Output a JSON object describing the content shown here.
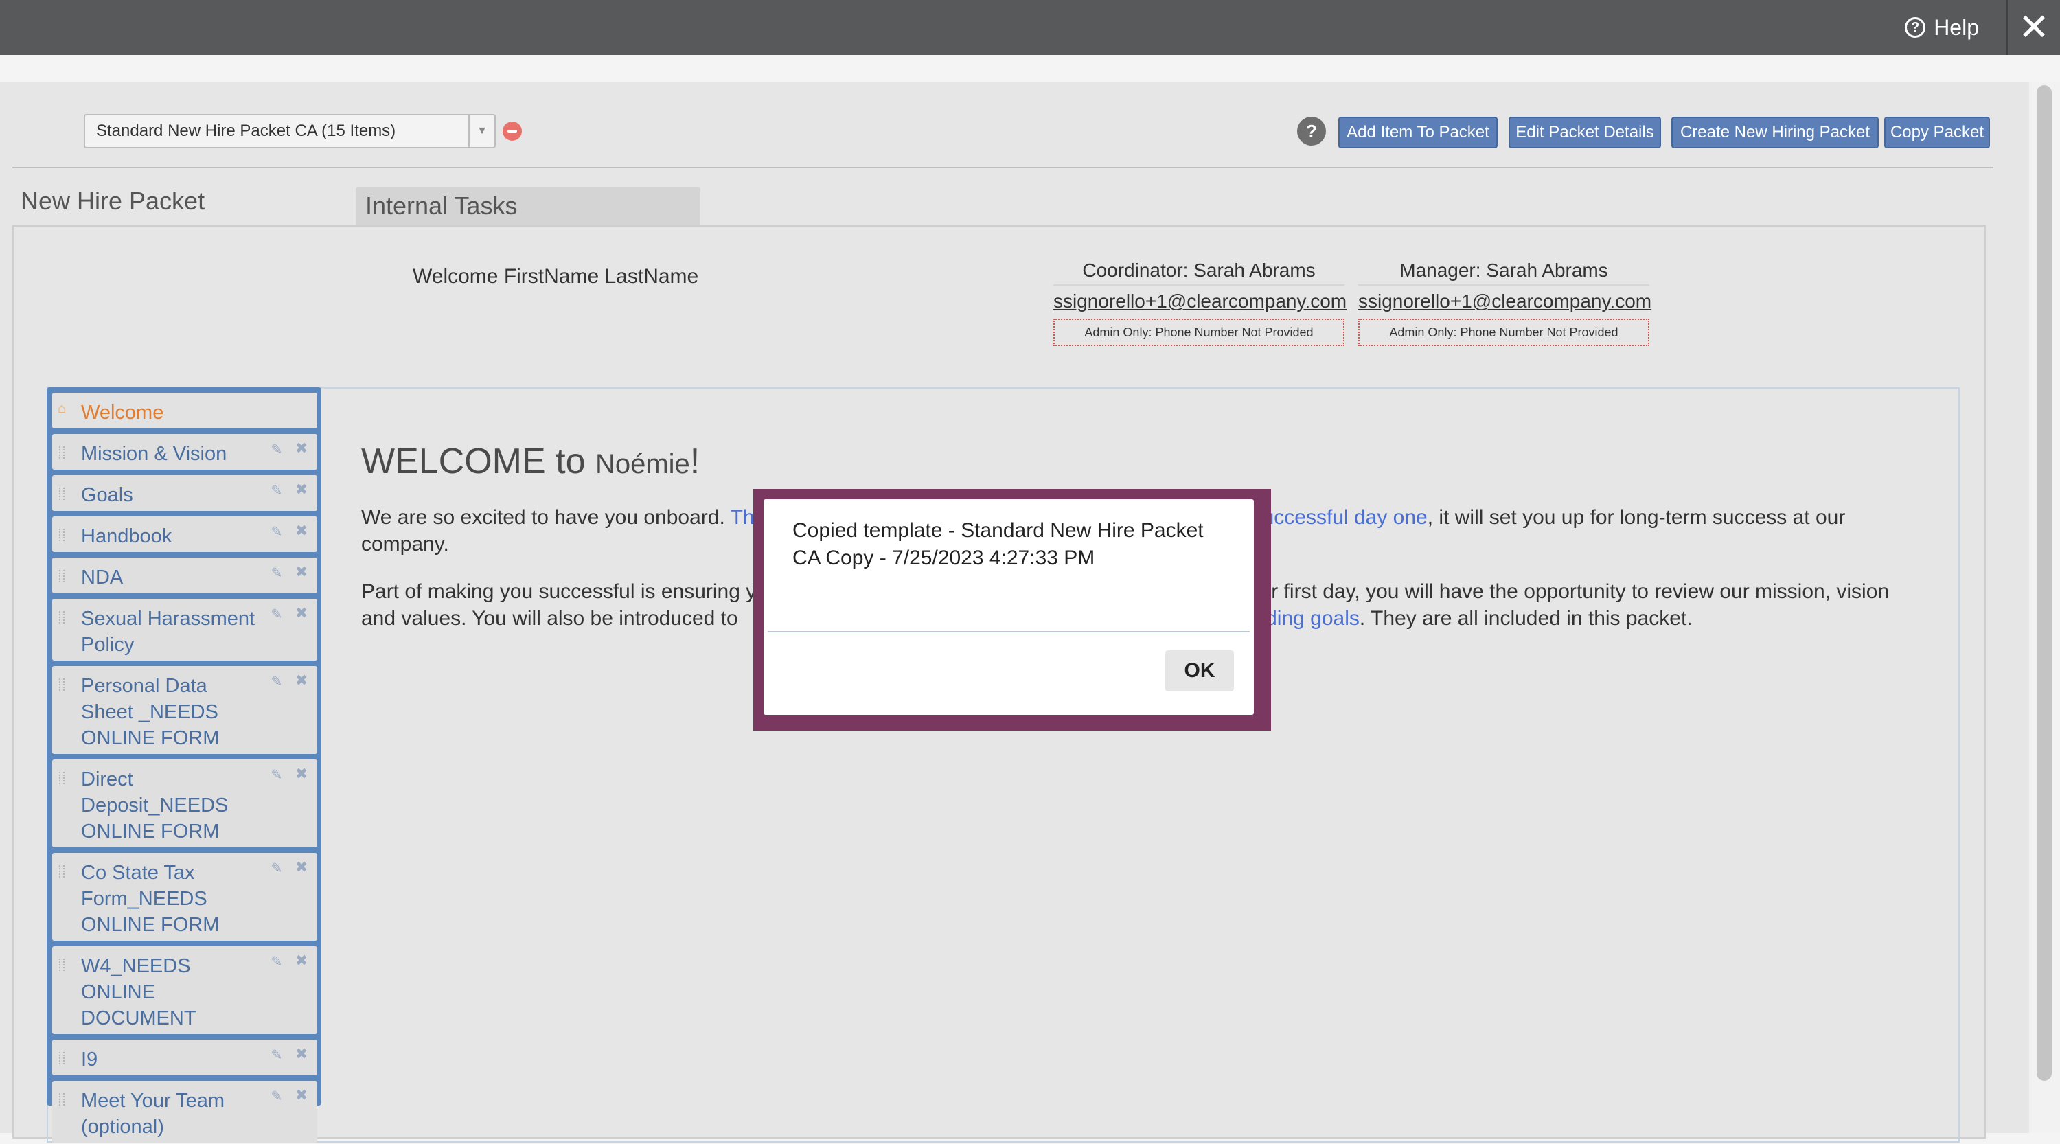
{
  "topbar": {
    "help_label": "Help",
    "help_icon_glyph": "?",
    "close_icon_glyph": "✕"
  },
  "packet": {
    "selected": "Standard New Hire Packet CA (15 Items)",
    "help_glyph": "?",
    "actions": {
      "add_item": "Add Item To Packet",
      "edit_details": "Edit Packet Details",
      "create_new": "Create New Hiring Packet",
      "copy": "Copy Packet"
    }
  },
  "tabs": {
    "new_hire": "New Hire Packet",
    "internal_tasks": "Internal Tasks"
  },
  "welcome_name": "Welcome FirstName LastName",
  "coordinator": {
    "title": "Coordinator: Sarah Abrams",
    "email": "ssignorello+1@clearcompany.com",
    "phone": "Admin Only: Phone Number Not Provided"
  },
  "manager": {
    "title": "Manager: Sarah Abrams",
    "email": "ssignorello+1@clearcompany.com",
    "phone": "Admin Only: Phone Number Not Provided"
  },
  "sidebar": {
    "items": [
      {
        "label": "Welcome"
      },
      {
        "label": "Mission & Vision"
      },
      {
        "label": "Goals"
      },
      {
        "label": "Handbook"
      },
      {
        "label": "NDA"
      },
      {
        "label": "Sexual Harassment Policy"
      },
      {
        "label": "Personal Data Sheet _NEEDS ONLINE FORM"
      },
      {
        "label": "Direct Deposit_NEEDS ONLINE FORM"
      },
      {
        "label": "Co State Tax Form_NEEDS ONLINE FORM"
      },
      {
        "label": "W4_NEEDS ONLINE DOCUMENT"
      },
      {
        "label": "I9"
      },
      {
        "label": "Meet Your Team (optional)"
      }
    ],
    "icons": {
      "home": "⌂",
      "edit": "✎",
      "delete": "✖"
    }
  },
  "main": {
    "heading_prefix": "WELCOME to ",
    "heading_name": "Noémie",
    "heading_suffix": "!",
    "p1_a": "We are so excited to have you onboard. ",
    "p1_link1": "Th",
    "p1_link2": "uccessful day one",
    "p1_b": ", it will set you up for long-term success at our company.",
    "p2_a": "Part of making you successful is ensuring y",
    "p2_mid": "r first day, you will have the opportunity to review our mission, vision and values. You will also be introduced to ",
    "p2_link": "boarding goals",
    "p2_b": ". They are all included in this packet."
  },
  "modal": {
    "message": "Copied template - Standard New Hire Packet CA Copy - 7/25/2023 4:27:33 PM",
    "ok_label": "OK"
  }
}
